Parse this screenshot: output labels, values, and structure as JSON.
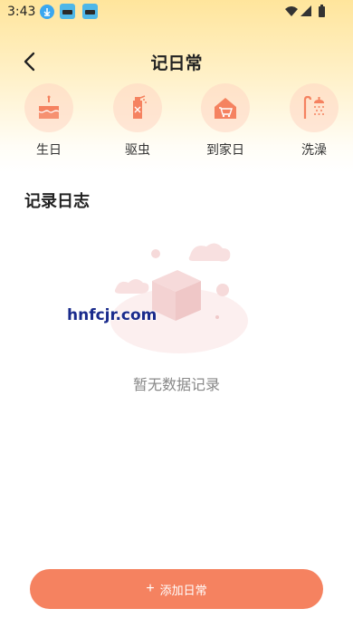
{
  "status_bar": {
    "time": "3:43"
  },
  "header": {
    "title": "记日常"
  },
  "categories": [
    {
      "label": "生日",
      "icon": "cake-icon"
    },
    {
      "label": "驱虫",
      "icon": "spray-icon"
    },
    {
      "label": "到家日",
      "icon": "home-cart-icon"
    },
    {
      "label": "洗澡",
      "icon": "shower-icon"
    }
  ],
  "log_section": {
    "title": "记录日志",
    "empty_text": "暂无数据记录"
  },
  "watermark": "hnfcjr.com",
  "footer": {
    "add_button_label": "添加日常"
  },
  "colors": {
    "accent": "#F58260",
    "icon_bg": "#FFD6C3",
    "header_gradient_top": "#FFE59C"
  }
}
